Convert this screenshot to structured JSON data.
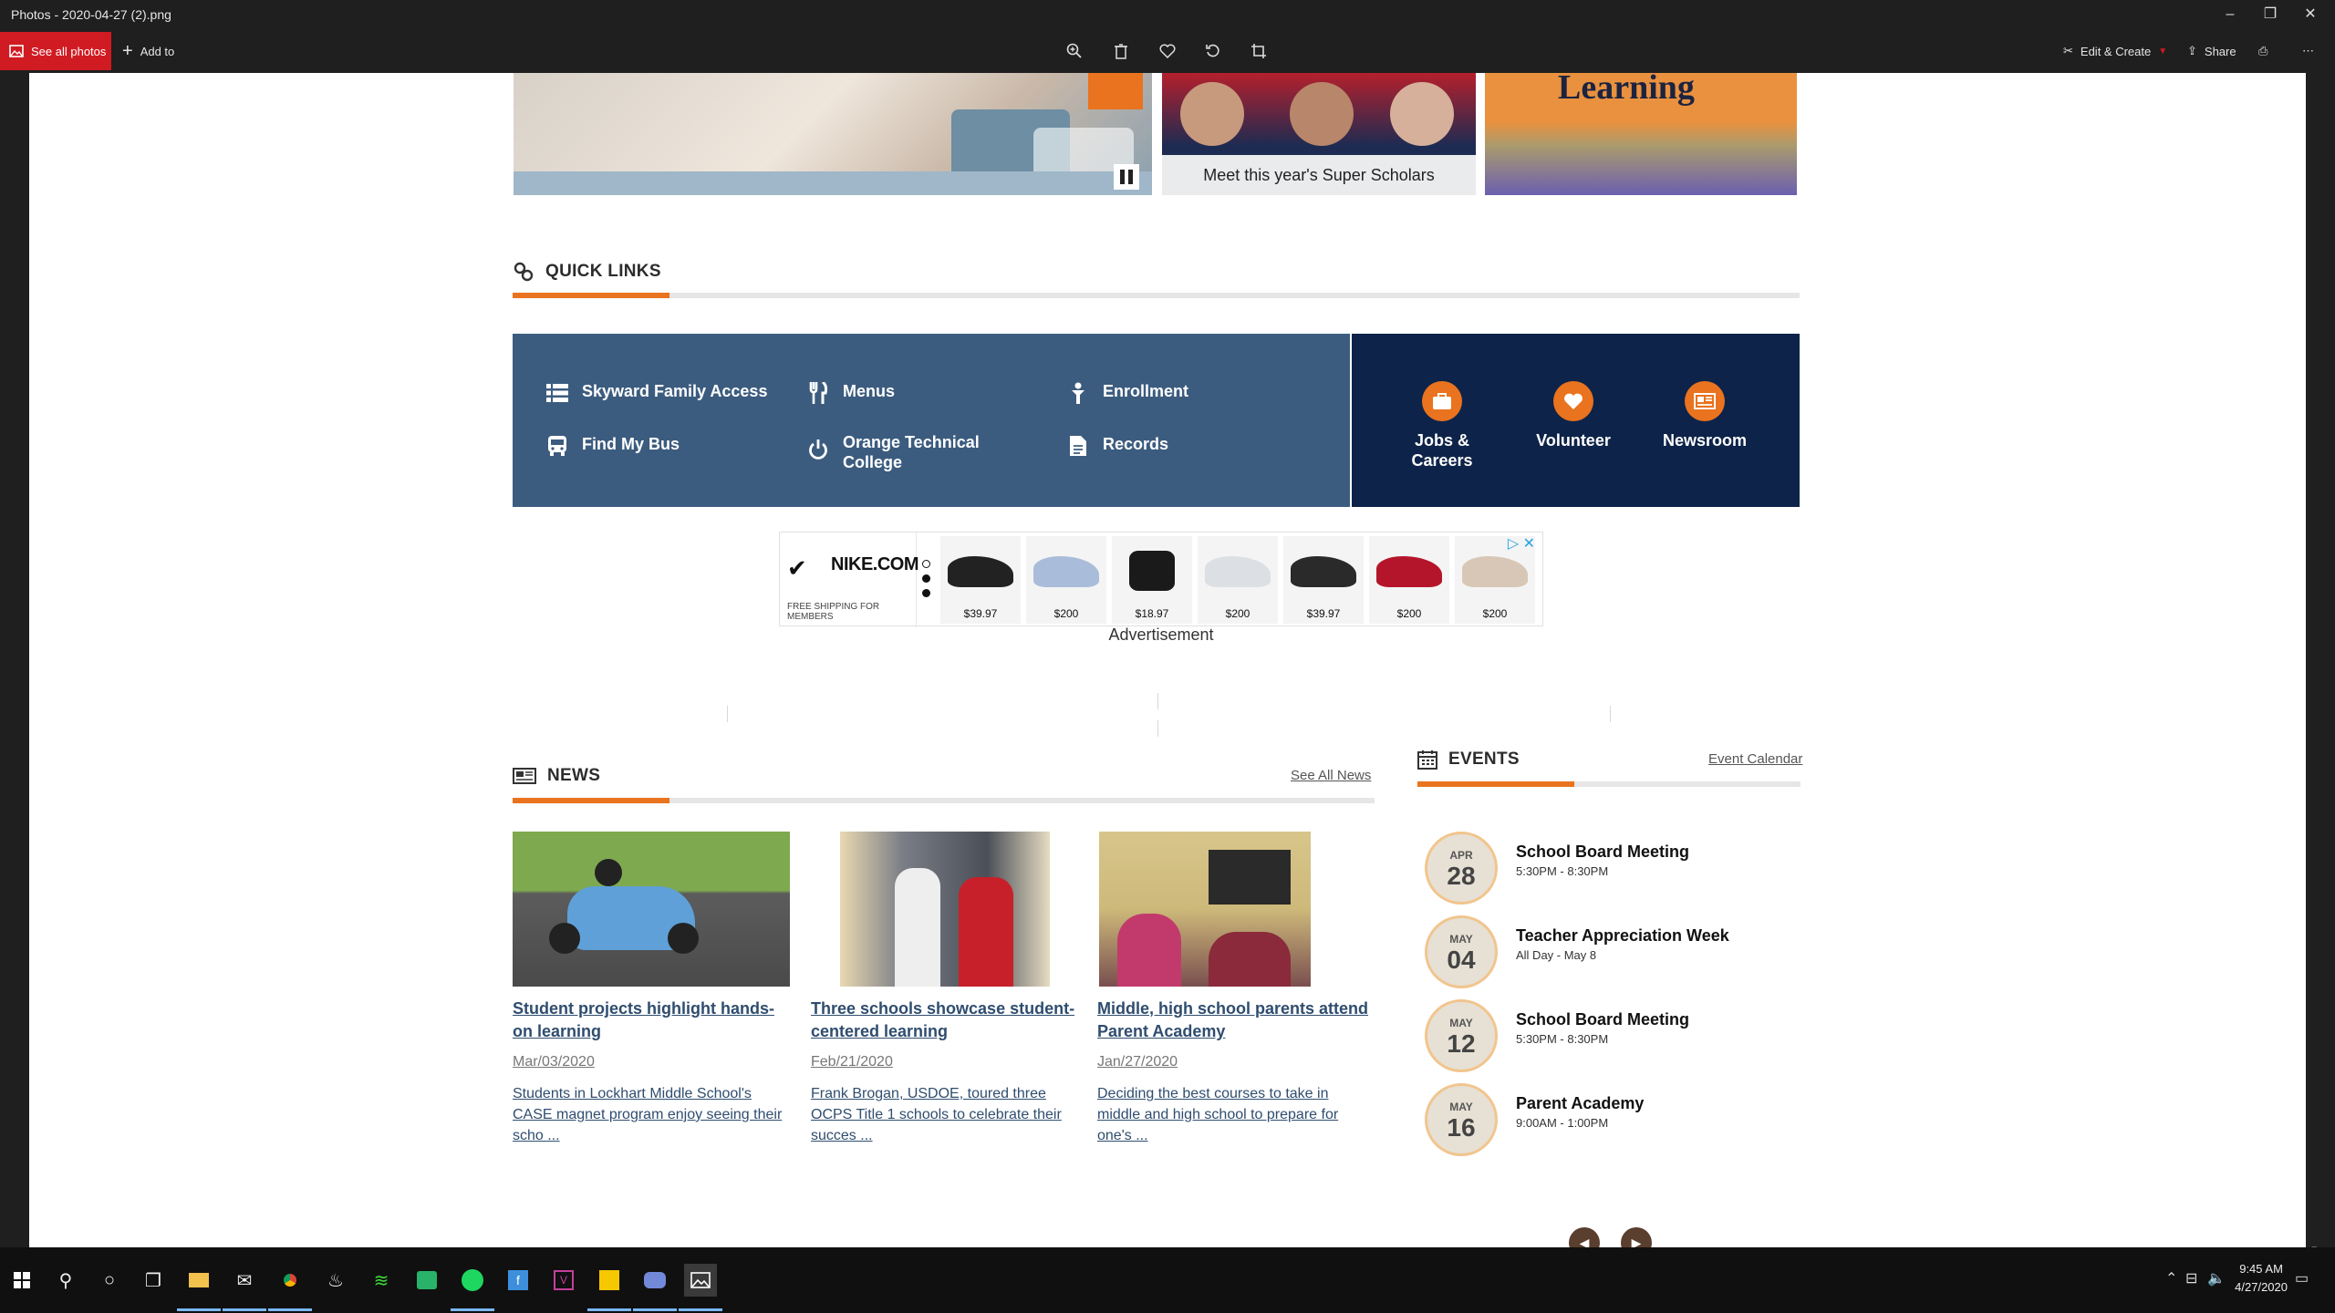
{
  "window": {
    "title": "Photos - 2020-04-27 (2).png",
    "minimize": "–",
    "restore": "❐",
    "close": "✕"
  },
  "toolbar": {
    "see_all_photos": "See all photos",
    "add_to": "Add to",
    "edit_create": "Edit & Create",
    "share": "Share",
    "more": "⋯"
  },
  "page": {
    "hero_caption": "Meet this year's Super Scholars",
    "hero_word": "Learning",
    "quick_links": {
      "heading": "QUICK LINKS",
      "items": [
        {
          "label": "Skyward Family Access",
          "icon": "list-icon"
        },
        {
          "label": "Menus",
          "icon": "utensils-icon"
        },
        {
          "label": "Enrollment",
          "icon": "person-icon"
        },
        {
          "label": "Find My Bus",
          "icon": "bus-icon"
        },
        {
          "label": "Orange Technical College",
          "icon": "power-icon"
        },
        {
          "label": "Records",
          "icon": "document-icon"
        }
      ],
      "featured": [
        {
          "label": "Jobs & Careers",
          "icon": "briefcase-icon"
        },
        {
          "label": "Volunteer",
          "icon": "heart-icon"
        },
        {
          "label": "Newsroom",
          "icon": "newspaper-icon"
        }
      ]
    },
    "ad": {
      "brand": "NIKE.COM",
      "shipping": "FREE SHIPPING FOR MEMBERS",
      "prices": [
        "$39.97",
        "$200",
        "$18.97",
        "$200",
        "$39.97",
        "$200",
        "$200"
      ],
      "label": "Advertisement"
    },
    "news": {
      "heading": "NEWS",
      "see_all": "See All News",
      "items": [
        {
          "headline": "Student projects highlight hands-on learning",
          "date": "Mar/03/2020",
          "summary": "Students in Lockhart Middle School's CASE magnet program enjoy seeing their scho ..."
        },
        {
          "headline": "Three schools showcase student-centered learning",
          "date": "Feb/21/2020",
          "summary": "Frank Brogan, USDOE, toured three OCPS Title 1 schools to celebrate their succes ..."
        },
        {
          "headline": "Middle, high school parents attend Parent Academy",
          "date": "Jan/27/2020",
          "summary": "Deciding the best courses to take in middle and high school to prepare for one's ..."
        }
      ]
    },
    "events": {
      "heading": "EVENTS",
      "calendar_link": "Event Calendar",
      "items": [
        {
          "month": "APR",
          "day": "28",
          "title": "School Board Meeting",
          "time": "5:30PM - 8:30PM"
        },
        {
          "month": "MAY",
          "day": "04",
          "title": "Teacher Appreciation Week",
          "time": "All Day - May 8"
        },
        {
          "month": "MAY",
          "day": "12",
          "title": "School Board Meeting",
          "time": "5:30PM - 8:30PM"
        },
        {
          "month": "MAY",
          "day": "16",
          "title": "Parent Academy",
          "time": "9:00AM - 1:00PM"
        }
      ]
    }
  },
  "taskbar": {
    "time": "9:45 AM",
    "date": "4/27/2020"
  },
  "colors": {
    "accent_orange": "#e9731e",
    "quick_links_blue": "#3c5c7f",
    "quick_links_navy": "#0d2349",
    "photos_red": "#d01b22"
  }
}
